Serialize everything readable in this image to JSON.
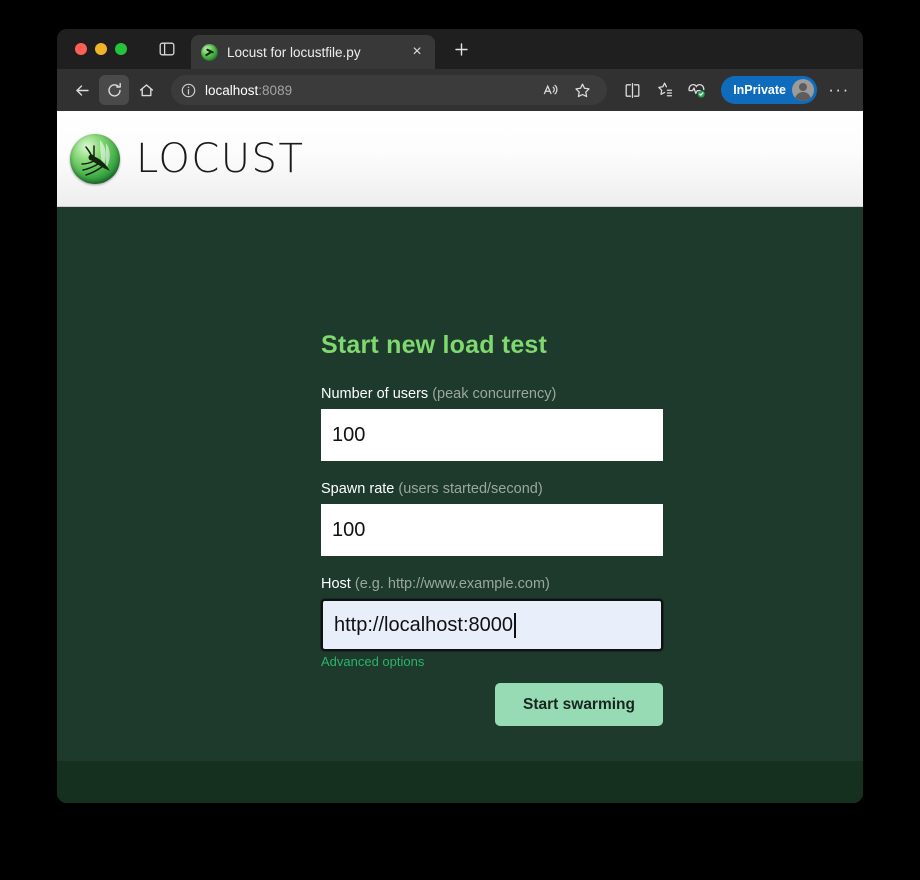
{
  "browser": {
    "tab": {
      "title": "Locust for locustfile.py",
      "favicon_name": "locust-favicon",
      "close_label": "×"
    },
    "new_tab_label": "+",
    "toolbar": {
      "back_label": "Back",
      "refresh_label": "Refresh",
      "home_label": "Home",
      "url_host": "localhost",
      "url_port": ":8089",
      "url_full": "localhost:8089",
      "read_aloud_label": "Read aloud",
      "favorite_label": "Add this page to favorites",
      "split_screen_label": "Split screen",
      "collections_label": "Collections",
      "browser_essentials_label": "Browser essentials",
      "inprivate_label": "InPrivate",
      "settings_label": "···"
    }
  },
  "site": {
    "brand": "LOCUST",
    "header_logo_name": "locust-logo"
  },
  "form": {
    "title": "Start new load test",
    "fields": [
      {
        "label": "Number of users",
        "hint": "(peak concurrency)",
        "value": "100",
        "focused": false
      },
      {
        "label": "Spawn rate",
        "hint": "(users started/second)",
        "value": "100",
        "focused": false
      },
      {
        "label": "Host",
        "hint": "(e.g. http://www.example.com)",
        "value": "http://localhost:8000",
        "focused": true
      }
    ],
    "advanced_options_label": "Advanced options",
    "submit_label": "Start swarming"
  },
  "colors": {
    "page_background": "#1d3a2c",
    "footer_background": "#16301f",
    "heading_green": "#7fd96e",
    "button_green": "#97dbb4",
    "link_green": "#2db36a",
    "focused_input_background": "#e9eefb",
    "inprivate_blue": "#0f6cbd"
  }
}
